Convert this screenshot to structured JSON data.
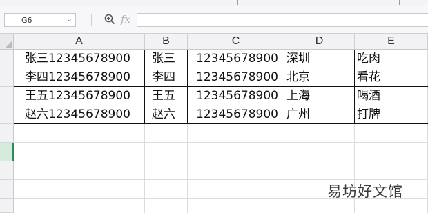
{
  "formula_bar": {
    "cell_ref": "G6",
    "fx_label": "fx",
    "formula": ""
  },
  "columns": [
    "A",
    "B",
    "C",
    "D",
    "E"
  ],
  "rows": [
    [
      "张三12345678900",
      "张三",
      "12345678900",
      "深圳",
      "吃肉"
    ],
    [
      "李四12345678900",
      "李四",
      "12345678900",
      "北京",
      "看花"
    ],
    [
      "王五12345678900",
      "王五",
      "12345678900",
      "上海",
      "喝酒"
    ],
    [
      "赵六12345678900",
      "赵六",
      "12345678900",
      "广州",
      "打牌"
    ]
  ],
  "selected_row": 6,
  "watermark": "易坊好文馆",
  "icons": {
    "zoom": "zoom-icon",
    "dropdown": "chevron-down-icon"
  }
}
